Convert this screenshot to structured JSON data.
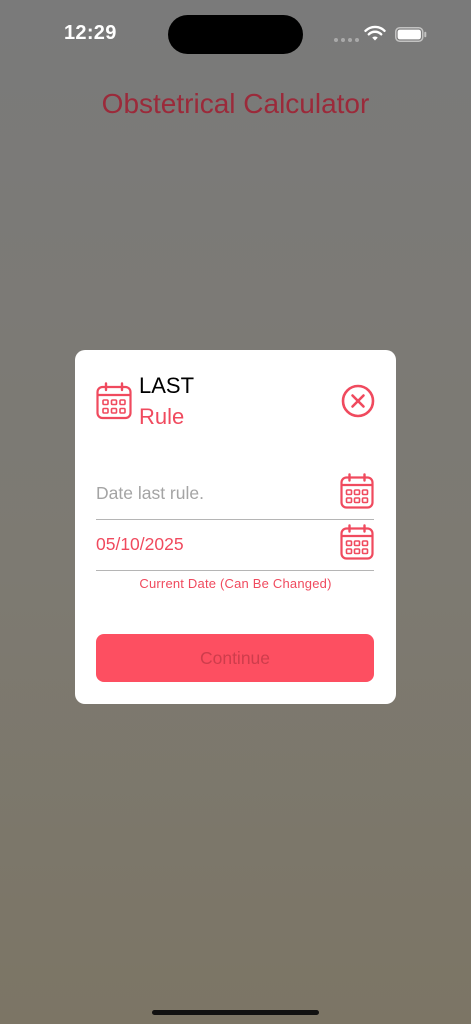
{
  "status_bar": {
    "time": "12:29",
    "icons": [
      "signal-dots-icon",
      "wifi-icon",
      "battery-icon"
    ]
  },
  "page": {
    "title": "Obstetrical Calculator"
  },
  "modal": {
    "header_icon": "calendar-icon",
    "title_line1": "LAST",
    "title_line2": "Rule",
    "close_icon": "close-circle-icon",
    "fields": [
      {
        "placeholder": "Date last rule.",
        "value": "",
        "icon": "calendar-icon"
      },
      {
        "placeholder": "",
        "value": "05/10/2025",
        "icon": "calendar-icon"
      }
    ],
    "helper_text": "Current Date (Can Be Changed)",
    "continue_label": "Continue"
  },
  "colors": {
    "accent": "#f04a5e",
    "button": "#fd4f61",
    "button_text": "#ce3d4c",
    "title": "#9b2a3a"
  }
}
